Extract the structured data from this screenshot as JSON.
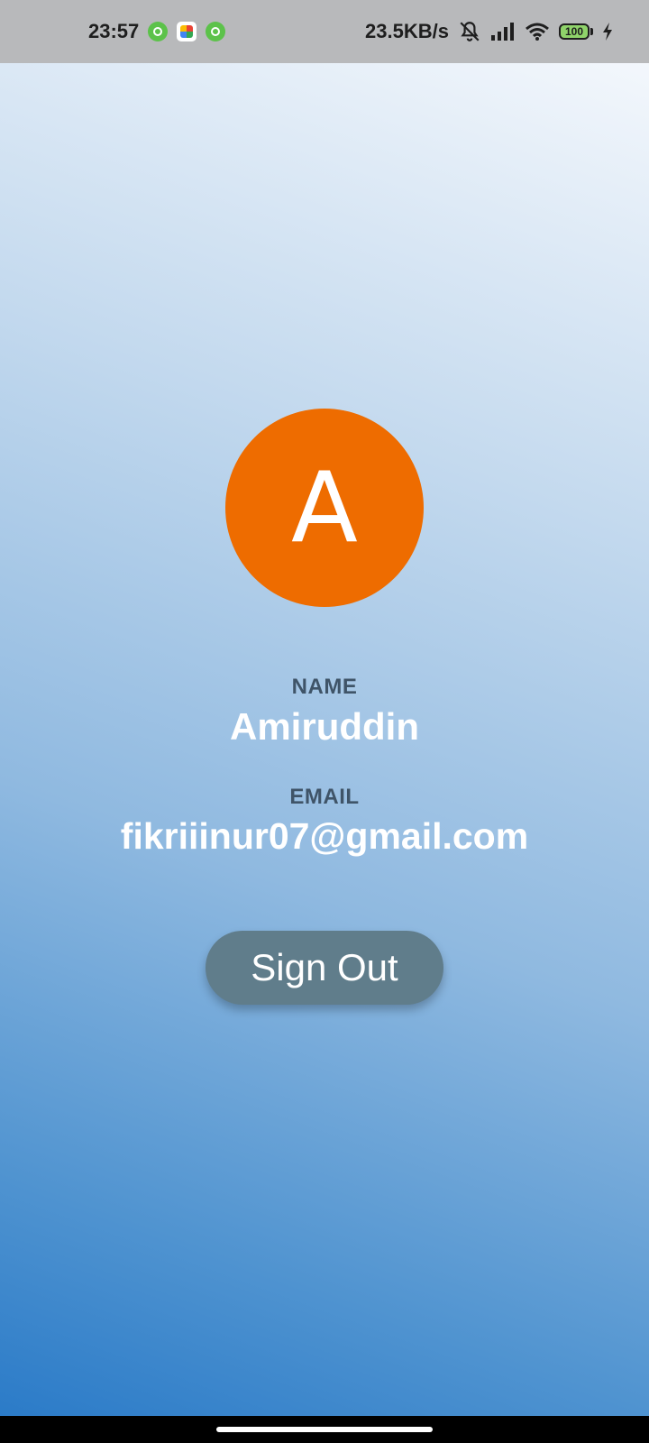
{
  "status_bar": {
    "time": "23:57",
    "notification_icons": [
      "android-robot-icon",
      "play-store-icon",
      "android-robot-icon"
    ],
    "network_speed": "23.5KB/s",
    "status_icons": [
      "mute-bell-icon",
      "signal-icon",
      "wifi-icon",
      "battery-icon",
      "charging-icon"
    ],
    "battery_level": "100"
  },
  "profile": {
    "avatar_letter": "A",
    "avatar_color": "#ee6c00",
    "name_label": "NAME",
    "name_value": "Amiruddin",
    "email_label": "EMAIL",
    "email_value": "fikriiinur07@gmail.com"
  },
  "actions": {
    "sign_out_label": "Sign Out",
    "sign_out_color": "#607d8b"
  }
}
